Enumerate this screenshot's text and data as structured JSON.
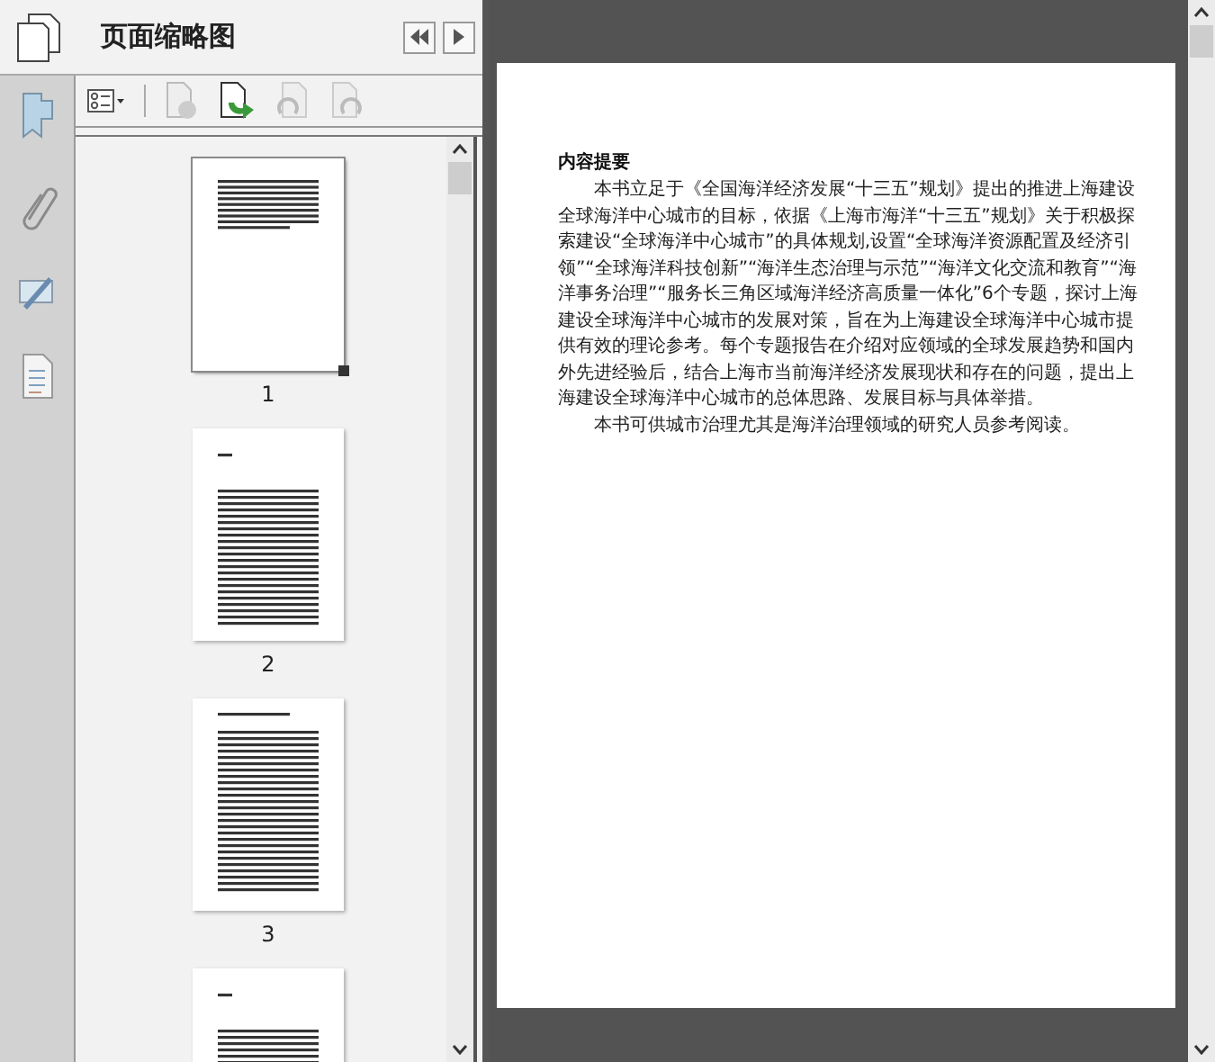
{
  "panel": {
    "title": "页面缩略图"
  },
  "thumbnails": [
    {
      "label": "1",
      "selected": true,
      "kind": "text"
    },
    {
      "label": "2",
      "selected": false,
      "kind": "preface"
    },
    {
      "label": "3",
      "selected": false,
      "kind": "dense"
    },
    {
      "selected": false,
      "kind": "preface"
    }
  ],
  "document": {
    "heading": "内容提要",
    "paragraphs": [
      "本书立足于《全国海洋经济发展“十三五”规划》提出的推进上海建设全球海洋中心城市的目标，依据《上海市海洋“十三五”规划》关于积极探索建设“全球海洋中心城市”的具体规划,设置“全球海洋资源配置及经济引领”“全球海洋科技创新”“海洋生态治理与示范”“海洋文化交流和教育”“海洋事务治理”“服务长三角区域海洋经济高质量一体化”6个专题，探讨上海建设全球海洋中心城市的发展对策，旨在为上海建设全球海洋中心城市提供有效的理论参考。每个专题报告在介绍对应领域的全球发展趋势和国内外先进经验后，结合上海市当前海洋经济发展现状和存在的问题，提出上海建设全球海洋中心城市的总体思路、发展目标与具体举措。",
      "本书可供城市治理尤其是海洋治理领域的研究人员参考阅读。"
    ]
  }
}
